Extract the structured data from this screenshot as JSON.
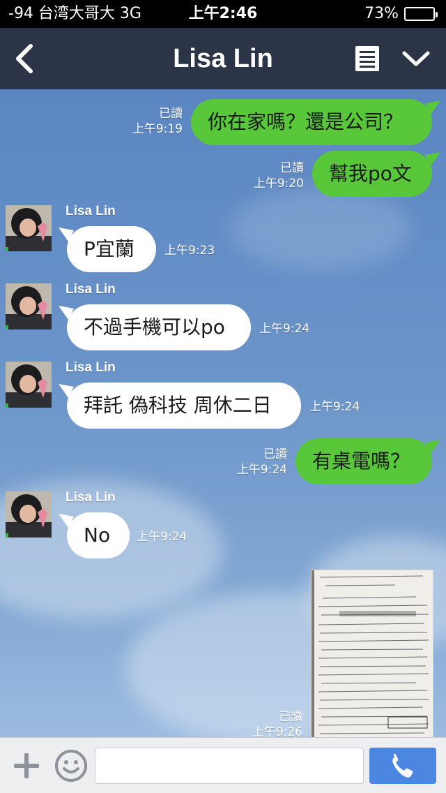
{
  "status_bar": {
    "carrier": "-94 台湾大哥大  3G",
    "time": "上午2:46",
    "battery": "73%",
    "battery_level": 0.73
  },
  "header": {
    "title": "Lisa Lin",
    "back_icon": "chevron-left-icon",
    "notes_icon": "notes-icon",
    "menu_icon": "chevron-down-icon"
  },
  "messages": [
    {
      "side": "right",
      "text": "你在家嗎？還是公司？",
      "read": "已讀",
      "time": "上午9:19"
    },
    {
      "side": "right",
      "text": "幫我po文",
      "read": "已讀",
      "time": "上午9:20"
    },
    {
      "side": "left",
      "sender": "Lisa Lin",
      "text": "P宜蘭",
      "time": "上午9:23"
    },
    {
      "side": "left",
      "sender": "Lisa Lin",
      "text": "不過手機可以po",
      "time": "上午9:24"
    },
    {
      "side": "left",
      "sender": "Lisa Lin",
      "text": "拜託 偽科技 周休二日",
      "time": "上午9:24"
    },
    {
      "side": "right",
      "text": "有桌電嗎？",
      "read": "已讀",
      "time": "上午9:24"
    },
    {
      "side": "left",
      "sender": "Lisa Lin",
      "text": "No",
      "time": "上午9:24"
    },
    {
      "side": "right",
      "type": "image",
      "read": "已讀",
      "time": "上午9:26"
    }
  ],
  "input_bar": {
    "plus_icon": "plus-icon",
    "emoji_icon": "smiley-icon",
    "placeholder": "",
    "call_icon": "phone-icon"
  },
  "colors": {
    "status_bar": "#000000",
    "nav_bar": "#2b3547",
    "bubble_sent": "#58c83a",
    "bubble_received": "#ffffff",
    "call_button": "#4b86e0"
  }
}
